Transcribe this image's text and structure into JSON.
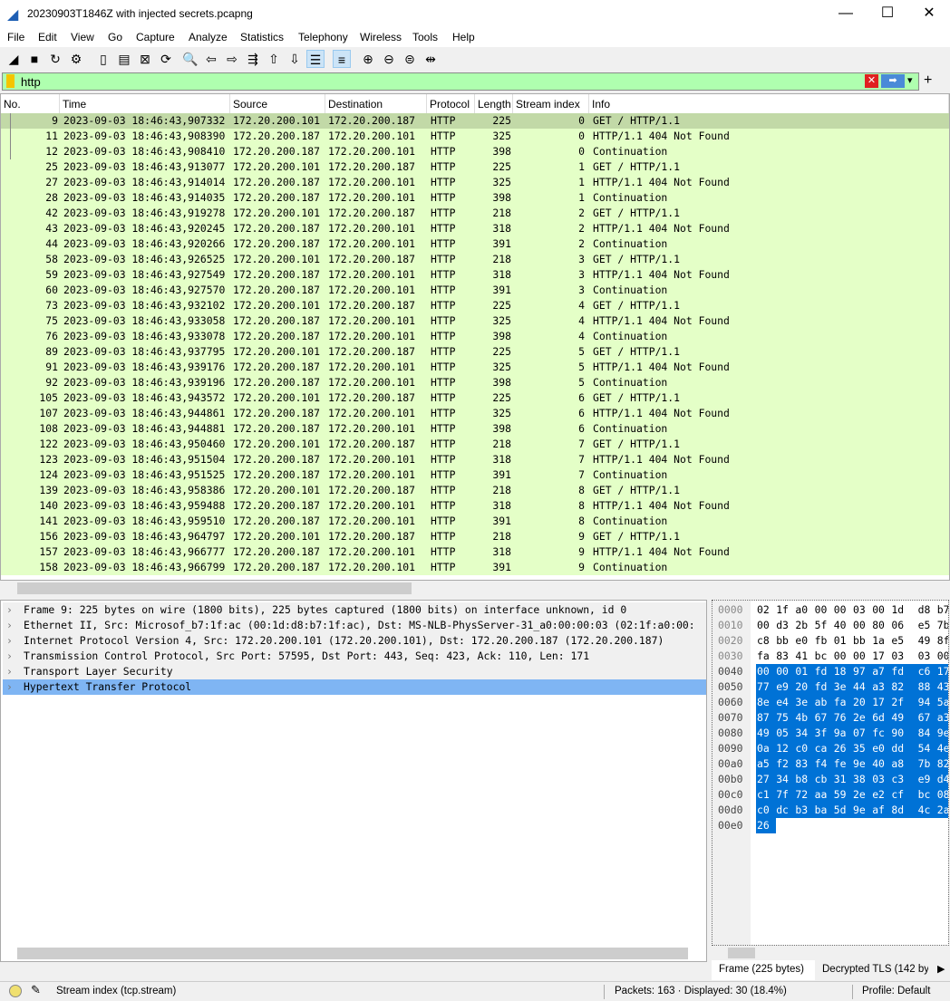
{
  "window": {
    "title": "20230903T1846Z with injected secrets.pcapng",
    "minimize": "—",
    "maximize": "☐",
    "close": "✕"
  },
  "menu": [
    "File",
    "Edit",
    "View",
    "Go",
    "Capture",
    "Analyze",
    "Statistics",
    "Telephony",
    "Wireless",
    "Tools",
    "Help"
  ],
  "toolbar": [
    {
      "icon": "shark-fin-start-icon",
      "glyph": "◢",
      "on": false
    },
    {
      "icon": "stop-icon",
      "glyph": "■",
      "on": false
    },
    {
      "icon": "restart-icon",
      "glyph": "↻",
      "on": false
    },
    {
      "icon": "options-gear-icon",
      "glyph": "⚙",
      "on": false
    },
    {
      "icon": "open-file-icon",
      "glyph": "▯",
      "on": false
    },
    {
      "icon": "save-file-icon",
      "glyph": "▤",
      "on": false
    },
    {
      "icon": "close-file-icon",
      "glyph": "⊠",
      "on": false
    },
    {
      "icon": "reload-icon",
      "glyph": "⟳",
      "on": false
    },
    {
      "icon": "find-icon",
      "glyph": "🔍",
      "on": false
    },
    {
      "icon": "back-arrow-icon",
      "glyph": "⇦",
      "on": false
    },
    {
      "icon": "forward-arrow-icon",
      "glyph": "⇨",
      "on": false
    },
    {
      "icon": "go-to-packet-icon",
      "glyph": "⇶",
      "on": false
    },
    {
      "icon": "first-packet-icon",
      "glyph": "⇧",
      "on": false
    },
    {
      "icon": "last-packet-icon",
      "glyph": "⇩",
      "on": false
    },
    {
      "icon": "autoscroll-icon",
      "glyph": "☰",
      "on": true
    },
    {
      "icon": "colorize-icon",
      "glyph": "≡",
      "on": true
    },
    {
      "icon": "zoom-in-icon",
      "glyph": "⊕",
      "on": false
    },
    {
      "icon": "zoom-out-icon",
      "glyph": "⊖",
      "on": false
    },
    {
      "icon": "zoom-normal-icon",
      "glyph": "⊜",
      "on": false
    },
    {
      "icon": "resize-columns-icon",
      "glyph": "⇹",
      "on": false
    }
  ],
  "filter": {
    "value": "http",
    "bg_color": "#afffaf",
    "add": "+",
    "clear": "✕",
    "apply": "➡",
    "dropdown": "▾"
  },
  "columns": [
    "No.",
    "Time",
    "Source",
    "Destination",
    "Protocol",
    "Length",
    "Stream index",
    "Info"
  ],
  "packets": [
    [
      "9",
      "2023-09-03 18:46:43,907332",
      "172.20.200.101",
      "172.20.200.187",
      "HTTP",
      "225",
      "0",
      "GET / HTTP/1.1"
    ],
    [
      "11",
      "2023-09-03 18:46:43,908390",
      "172.20.200.187",
      "172.20.200.101",
      "HTTP",
      "325",
      "0",
      "HTTP/1.1 404 Not Found"
    ],
    [
      "12",
      "2023-09-03 18:46:43,908410",
      "172.20.200.187",
      "172.20.200.101",
      "HTTP",
      "398",
      "0",
      "Continuation"
    ],
    [
      "25",
      "2023-09-03 18:46:43,913077",
      "172.20.200.101",
      "172.20.200.187",
      "HTTP",
      "225",
      "1",
      "GET / HTTP/1.1"
    ],
    [
      "27",
      "2023-09-03 18:46:43,914014",
      "172.20.200.187",
      "172.20.200.101",
      "HTTP",
      "325",
      "1",
      "HTTP/1.1 404 Not Found"
    ],
    [
      "28",
      "2023-09-03 18:46:43,914035",
      "172.20.200.187",
      "172.20.200.101",
      "HTTP",
      "398",
      "1",
      "Continuation"
    ],
    [
      "42",
      "2023-09-03 18:46:43,919278",
      "172.20.200.101",
      "172.20.200.187",
      "HTTP",
      "218",
      "2",
      "GET / HTTP/1.1"
    ],
    [
      "43",
      "2023-09-03 18:46:43,920245",
      "172.20.200.187",
      "172.20.200.101",
      "HTTP",
      "318",
      "2",
      "HTTP/1.1 404 Not Found"
    ],
    [
      "44",
      "2023-09-03 18:46:43,920266",
      "172.20.200.187",
      "172.20.200.101",
      "HTTP",
      "391",
      "2",
      "Continuation"
    ],
    [
      "58",
      "2023-09-03 18:46:43,926525",
      "172.20.200.101",
      "172.20.200.187",
      "HTTP",
      "218",
      "3",
      "GET / HTTP/1.1"
    ],
    [
      "59",
      "2023-09-03 18:46:43,927549",
      "172.20.200.187",
      "172.20.200.101",
      "HTTP",
      "318",
      "3",
      "HTTP/1.1 404 Not Found"
    ],
    [
      "60",
      "2023-09-03 18:46:43,927570",
      "172.20.200.187",
      "172.20.200.101",
      "HTTP",
      "391",
      "3",
      "Continuation"
    ],
    [
      "73",
      "2023-09-03 18:46:43,932102",
      "172.20.200.101",
      "172.20.200.187",
      "HTTP",
      "225",
      "4",
      "GET / HTTP/1.1"
    ],
    [
      "75",
      "2023-09-03 18:46:43,933058",
      "172.20.200.187",
      "172.20.200.101",
      "HTTP",
      "325",
      "4",
      "HTTP/1.1 404 Not Found"
    ],
    [
      "76",
      "2023-09-03 18:46:43,933078",
      "172.20.200.187",
      "172.20.200.101",
      "HTTP",
      "398",
      "4",
      "Continuation"
    ],
    [
      "89",
      "2023-09-03 18:46:43,937795",
      "172.20.200.101",
      "172.20.200.187",
      "HTTP",
      "225",
      "5",
      "GET / HTTP/1.1"
    ],
    [
      "91",
      "2023-09-03 18:46:43,939176",
      "172.20.200.187",
      "172.20.200.101",
      "HTTP",
      "325",
      "5",
      "HTTP/1.1 404 Not Found"
    ],
    [
      "92",
      "2023-09-03 18:46:43,939196",
      "172.20.200.187",
      "172.20.200.101",
      "HTTP",
      "398",
      "5",
      "Continuation"
    ],
    [
      "105",
      "2023-09-03 18:46:43,943572",
      "172.20.200.101",
      "172.20.200.187",
      "HTTP",
      "225",
      "6",
      "GET / HTTP/1.1"
    ],
    [
      "107",
      "2023-09-03 18:46:43,944861",
      "172.20.200.187",
      "172.20.200.101",
      "HTTP",
      "325",
      "6",
      "HTTP/1.1 404 Not Found"
    ],
    [
      "108",
      "2023-09-03 18:46:43,944881",
      "172.20.200.187",
      "172.20.200.101",
      "HTTP",
      "398",
      "6",
      "Continuation"
    ],
    [
      "122",
      "2023-09-03 18:46:43,950460",
      "172.20.200.101",
      "172.20.200.187",
      "HTTP",
      "218",
      "7",
      "GET / HTTP/1.1"
    ],
    [
      "123",
      "2023-09-03 18:46:43,951504",
      "172.20.200.187",
      "172.20.200.101",
      "HTTP",
      "318",
      "7",
      "HTTP/1.1 404 Not Found"
    ],
    [
      "124",
      "2023-09-03 18:46:43,951525",
      "172.20.200.187",
      "172.20.200.101",
      "HTTP",
      "391",
      "7",
      "Continuation"
    ],
    [
      "139",
      "2023-09-03 18:46:43,958386",
      "172.20.200.101",
      "172.20.200.187",
      "HTTP",
      "218",
      "8",
      "GET / HTTP/1.1"
    ],
    [
      "140",
      "2023-09-03 18:46:43,959488",
      "172.20.200.187",
      "172.20.200.101",
      "HTTP",
      "318",
      "8",
      "HTTP/1.1 404 Not Found"
    ],
    [
      "141",
      "2023-09-03 18:46:43,959510",
      "172.20.200.187",
      "172.20.200.101",
      "HTTP",
      "391",
      "8",
      "Continuation"
    ],
    [
      "156",
      "2023-09-03 18:46:43,964797",
      "172.20.200.101",
      "172.20.200.187",
      "HTTP",
      "218",
      "9",
      "GET / HTTP/1.1"
    ],
    [
      "157",
      "2023-09-03 18:46:43,966777",
      "172.20.200.187",
      "172.20.200.101",
      "HTTP",
      "318",
      "9",
      "HTTP/1.1 404 Not Found"
    ],
    [
      "158",
      "2023-09-03 18:46:43,966799",
      "172.20.200.187",
      "172.20.200.101",
      "HTTP",
      "391",
      "9",
      "Continuation"
    ]
  ],
  "selected_packet": "9",
  "details": [
    "Frame 9: 225 bytes on wire (1800 bits), 225 bytes captured (1800 bits) on interface unknown, id 0",
    "Ethernet II, Src: Microsof_b7:1f:ac (00:1d:d8:b7:1f:ac), Dst: MS-NLB-PhysServer-31_a0:00:00:03 (02:1f:a0:00:",
    "Internet Protocol Version 4, Src: 172.20.200.101 (172.20.200.101), Dst: 172.20.200.187 (172.20.200.187)",
    "Transmission Control Protocol, Src Port: 57595, Dst Port: 443, Seq: 423, Ack: 110, Len: 171",
    "Transport Layer Security",
    "Hypertext Transfer Protocol"
  ],
  "selected_detail": 5,
  "hex": [
    {
      "off": "0000",
      "bytes": [
        "02",
        "1f",
        "a0",
        "00",
        "00",
        "03",
        "00",
        "1d",
        "d8",
        "b7"
      ]
    },
    {
      "off": "0010",
      "bytes": [
        "00",
        "d3",
        "2b",
        "5f",
        "40",
        "00",
        "80",
        "06",
        "e5",
        "7b"
      ]
    },
    {
      "off": "0020",
      "bytes": [
        "c8",
        "bb",
        "e0",
        "fb",
        "01",
        "bb",
        "1a",
        "e5",
        "49",
        "8f"
      ]
    },
    {
      "off": "0030",
      "bytes": [
        "fa",
        "83",
        "41",
        "bc",
        "00",
        "00",
        "17",
        "03",
        "03",
        "00"
      ]
    },
    {
      "off": "0040",
      "bytes": [
        "00",
        "00",
        "01",
        "fd",
        "18",
        "97",
        "a7",
        "fd",
        "c6",
        "17"
      ]
    },
    {
      "off": "0050",
      "bytes": [
        "77",
        "e9",
        "20",
        "fd",
        "3e",
        "44",
        "a3",
        "82",
        "88",
        "43"
      ]
    },
    {
      "off": "0060",
      "bytes": [
        "8e",
        "e4",
        "3e",
        "ab",
        "fa",
        "20",
        "17",
        "2f",
        "94",
        "5a"
      ]
    },
    {
      "off": "0070",
      "bytes": [
        "87",
        "75",
        "4b",
        "67",
        "76",
        "2e",
        "6d",
        "49",
        "67",
        "a3"
      ]
    },
    {
      "off": "0080",
      "bytes": [
        "49",
        "05",
        "34",
        "3f",
        "9a",
        "07",
        "fc",
        "90",
        "84",
        "9e"
      ]
    },
    {
      "off": "0090",
      "bytes": [
        "0a",
        "12",
        "c0",
        "ca",
        "26",
        "35",
        "e0",
        "dd",
        "54",
        "4e"
      ]
    },
    {
      "off": "00a0",
      "bytes": [
        "a5",
        "f2",
        "83",
        "f4",
        "fe",
        "9e",
        "40",
        "a8",
        "7b",
        "82"
      ]
    },
    {
      "off": "00b0",
      "bytes": [
        "27",
        "34",
        "b8",
        "cb",
        "31",
        "38",
        "03",
        "c3",
        "e9",
        "d4"
      ]
    },
    {
      "off": "00c0",
      "bytes": [
        "c1",
        "7f",
        "72",
        "aa",
        "59",
        "2e",
        "e2",
        "cf",
        "bc",
        "08"
      ]
    },
    {
      "off": "00d0",
      "bytes": [
        "c0",
        "dc",
        "b3",
        "ba",
        "5d",
        "9e",
        "af",
        "8d",
        "4c",
        "2a"
      ]
    },
    {
      "off": "00e0",
      "bytes": [
        "26"
      ]
    }
  ],
  "hex_highlight_from_row": 4,
  "byte_tabs": [
    "Frame (225 bytes)",
    "Decrypted TLS (142 by"
  ],
  "status": {
    "field": "Stream index (tcp.stream)",
    "packets": "Packets: 163 · Displayed: 30 (18.4%)",
    "profile": "Profile: Default"
  },
  "colors": {
    "row_bg": "#e4ffc7",
    "row_selected": "#c2d9a7",
    "detail_selected": "#7fb5f3",
    "hex_highlight": "#0072d6"
  }
}
